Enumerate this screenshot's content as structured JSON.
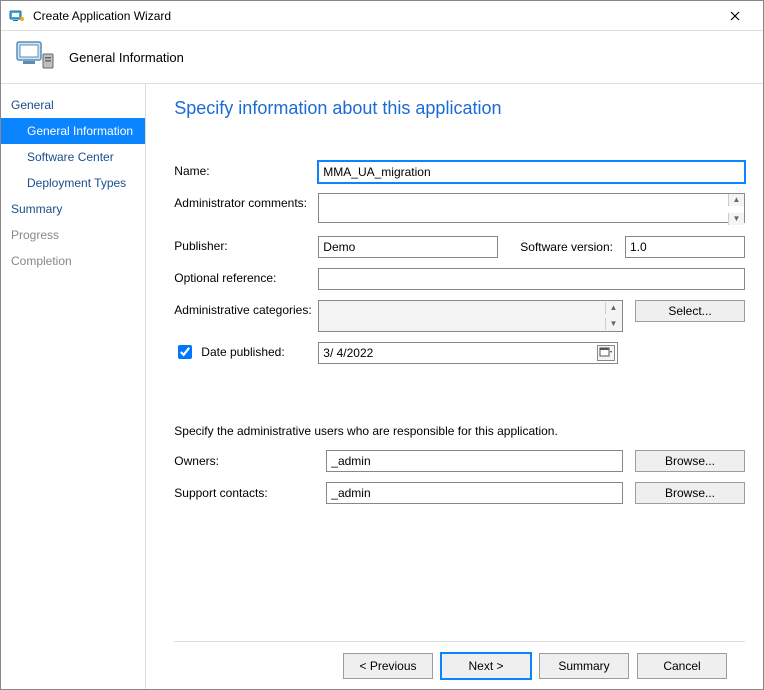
{
  "window": {
    "title": "Create Application Wizard"
  },
  "header": {
    "page_title": "General Information"
  },
  "sidebar": {
    "items": [
      {
        "label": "General",
        "level": 0,
        "state": "link"
      },
      {
        "label": "General Information",
        "level": 1,
        "state": "selected"
      },
      {
        "label": "Software Center",
        "level": 1,
        "state": "link"
      },
      {
        "label": "Deployment Types",
        "level": 1,
        "state": "link"
      },
      {
        "label": "Summary",
        "level": 0,
        "state": "link"
      },
      {
        "label": "Progress",
        "level": 0,
        "state": "dim"
      },
      {
        "label": "Completion",
        "level": 0,
        "state": "dim"
      }
    ]
  },
  "main": {
    "title": "Specify information about this application",
    "labels": {
      "name": "Name:",
      "admin_comm": "Administrator comments:",
      "publisher": "Publisher:",
      "sw_version": "Software version:",
      "opt_ref": "Optional reference:",
      "admin_cat": "Administrative categories:",
      "select_btn": "Select...",
      "date_pub": "Date published:",
      "subhead": "Specify the administrative users who are responsible for this application.",
      "owners": "Owners:",
      "support": "Support contacts:",
      "browse_btn": "Browse..."
    },
    "values": {
      "name": "MMA_UA_migration",
      "admin_comm": "",
      "publisher": "Demo",
      "sw_version": "1.0",
      "opt_ref": "",
      "date_pub_checked": true,
      "date_pub": "3/  4/2022",
      "owners": "_admin",
      "support": "_admin"
    }
  },
  "footer": {
    "previous": "< Previous",
    "next": "Next >",
    "summary": "Summary",
    "cancel": "Cancel"
  }
}
